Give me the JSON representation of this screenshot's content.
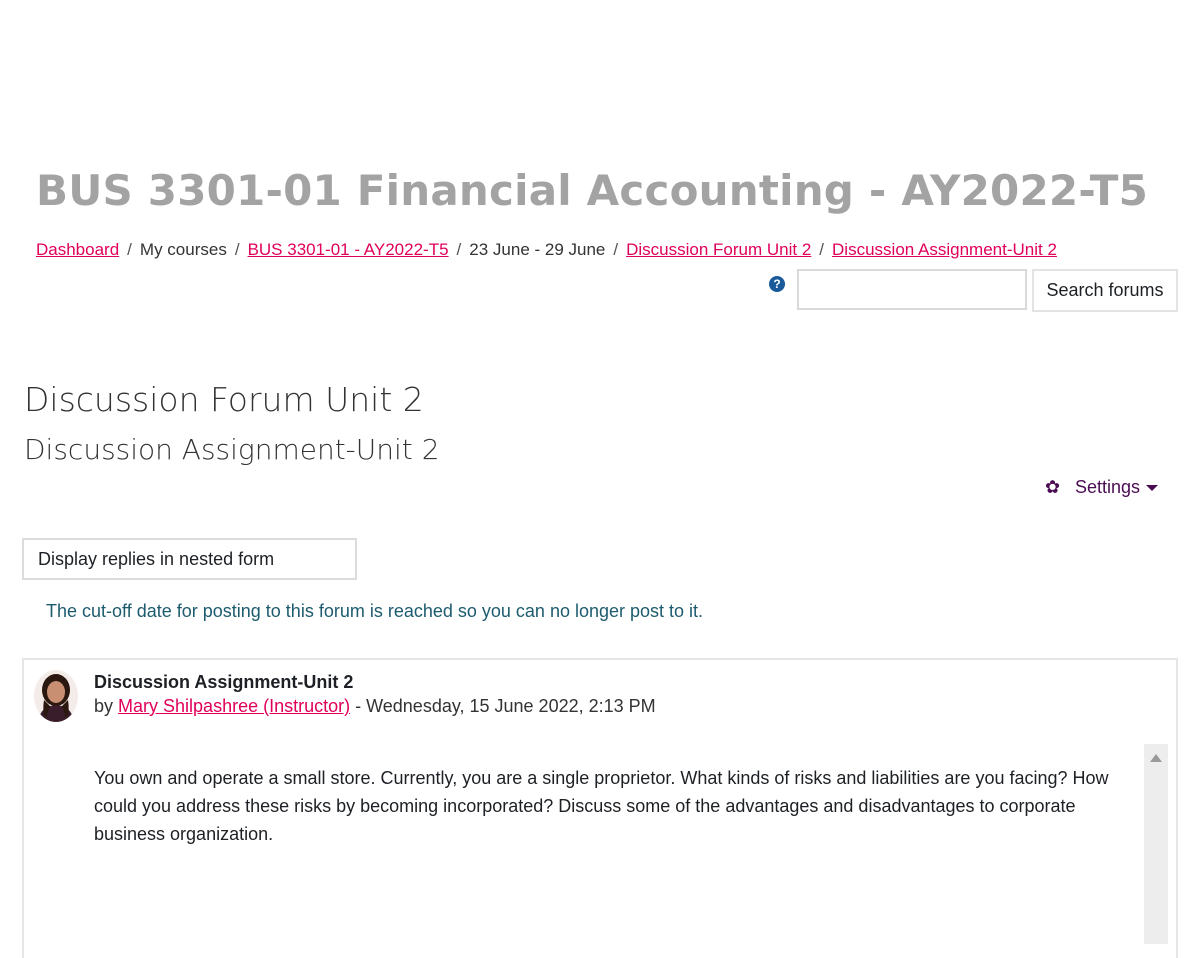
{
  "course": {
    "title": "BUS 3301-01 Financial Accounting - AY2022-T5"
  },
  "breadcrumb": {
    "items": [
      {
        "label": "Dashboard",
        "link": true
      },
      {
        "label": "My courses",
        "link": false
      },
      {
        "label": "BUS 3301-01 - AY2022-T5",
        "link": true
      },
      {
        "label": "23 June - 29 June",
        "link": false
      },
      {
        "label": "Discussion Forum Unit 2",
        "link": true
      },
      {
        "label": "Discussion Assignment-Unit 2",
        "link": true
      }
    ],
    "separator": "/"
  },
  "search": {
    "help_icon": "question-circle-icon",
    "placeholder": "",
    "value": "",
    "button_label": "Search forums"
  },
  "forum": {
    "title": "Discussion Forum Unit 2",
    "discussion_title": "Discussion Assignment-Unit 2"
  },
  "settings": {
    "label": "Settings",
    "icon": "gear-icon"
  },
  "display_mode": {
    "selected": "Display replies in nested form"
  },
  "notice": {
    "text": "The cut-off date for posting to this forum is reached so you can no longer post to it."
  },
  "post": {
    "subject": "Discussion Assignment-Unit 2",
    "by_prefix": "by",
    "author": "Mary Shilpashree (Instructor)",
    "date": " - Wednesday, 15 June 2022, 2:13 PM",
    "body": "You own and operate a small store. Currently, you are a single proprietor. What kinds of risks and liabilities are you facing? How could you address these risks by becoming incorporated? Discuss some of the advantages and disadvantages to corporate business organization."
  },
  "colors": {
    "link": "#e0005a",
    "settings": "#4b0c53",
    "notice": "#1d5b6e",
    "title_grey": "#a3a3a3"
  }
}
